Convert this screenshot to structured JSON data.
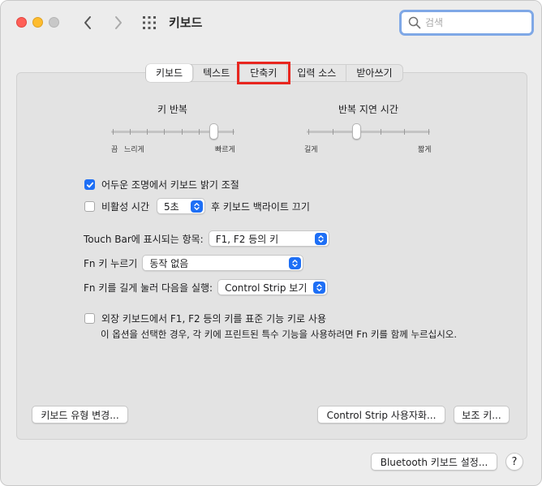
{
  "window": {
    "title": "키보드",
    "search_placeholder": "검색"
  },
  "tabs": [
    {
      "label": "키보드",
      "active": true
    },
    {
      "label": "텍스트",
      "active": false
    },
    {
      "label": "단축키",
      "active": false,
      "highlighted": true
    },
    {
      "label": "입력 소스",
      "active": false
    },
    {
      "label": "받아쓰기",
      "active": false
    }
  ],
  "key_repeat": {
    "title": "키 반복",
    "left_label": "끔",
    "mid_label": "느리게",
    "right_label": "빠르게",
    "level_fraction": 0.86
  },
  "repeat_delay": {
    "title": "반복 지연 시간",
    "left_label": "길게",
    "right_label": "짧게",
    "level_fraction": 0.4
  },
  "options": {
    "adjust_brightness": {
      "label": "어두운 조명에서 키보드 밝기 조절",
      "checked": true
    },
    "backlight_off": {
      "label_before": "비활성 시간",
      "value": "5초",
      "label_after": "후 키보드 백라이트 끄기",
      "checked": false
    }
  },
  "touch_bar": {
    "label": "Touch Bar에 표시되는 항목:",
    "value": "F1, F2 등의 키"
  },
  "fn_key": {
    "label": "Fn 키 누르기",
    "value": "동작 없음"
  },
  "fn_hold": {
    "label": "Fn 키를 길게 눌러 다음을 실행:",
    "value": "Control Strip 보기"
  },
  "function_keys": {
    "label": "외장 키보드에서 F1, F2 등의 키를 표준 기능 키로 사용",
    "description": "이 옵션을 선택한 경우, 각 키에 프린트된 특수 기능을 사용하려면 Fn 키를 함께 누르십시오.",
    "checked": false
  },
  "buttons": {
    "change_type": "키보드 유형 변경...",
    "customize_strip": "Control Strip 사용자화...",
    "modifier_keys": "보조 키...",
    "bluetooth": "Bluetooth 키보드 설정...",
    "help": "?"
  },
  "colors": {
    "accent": "#1e6ff5",
    "highlight": "#e8261f"
  }
}
